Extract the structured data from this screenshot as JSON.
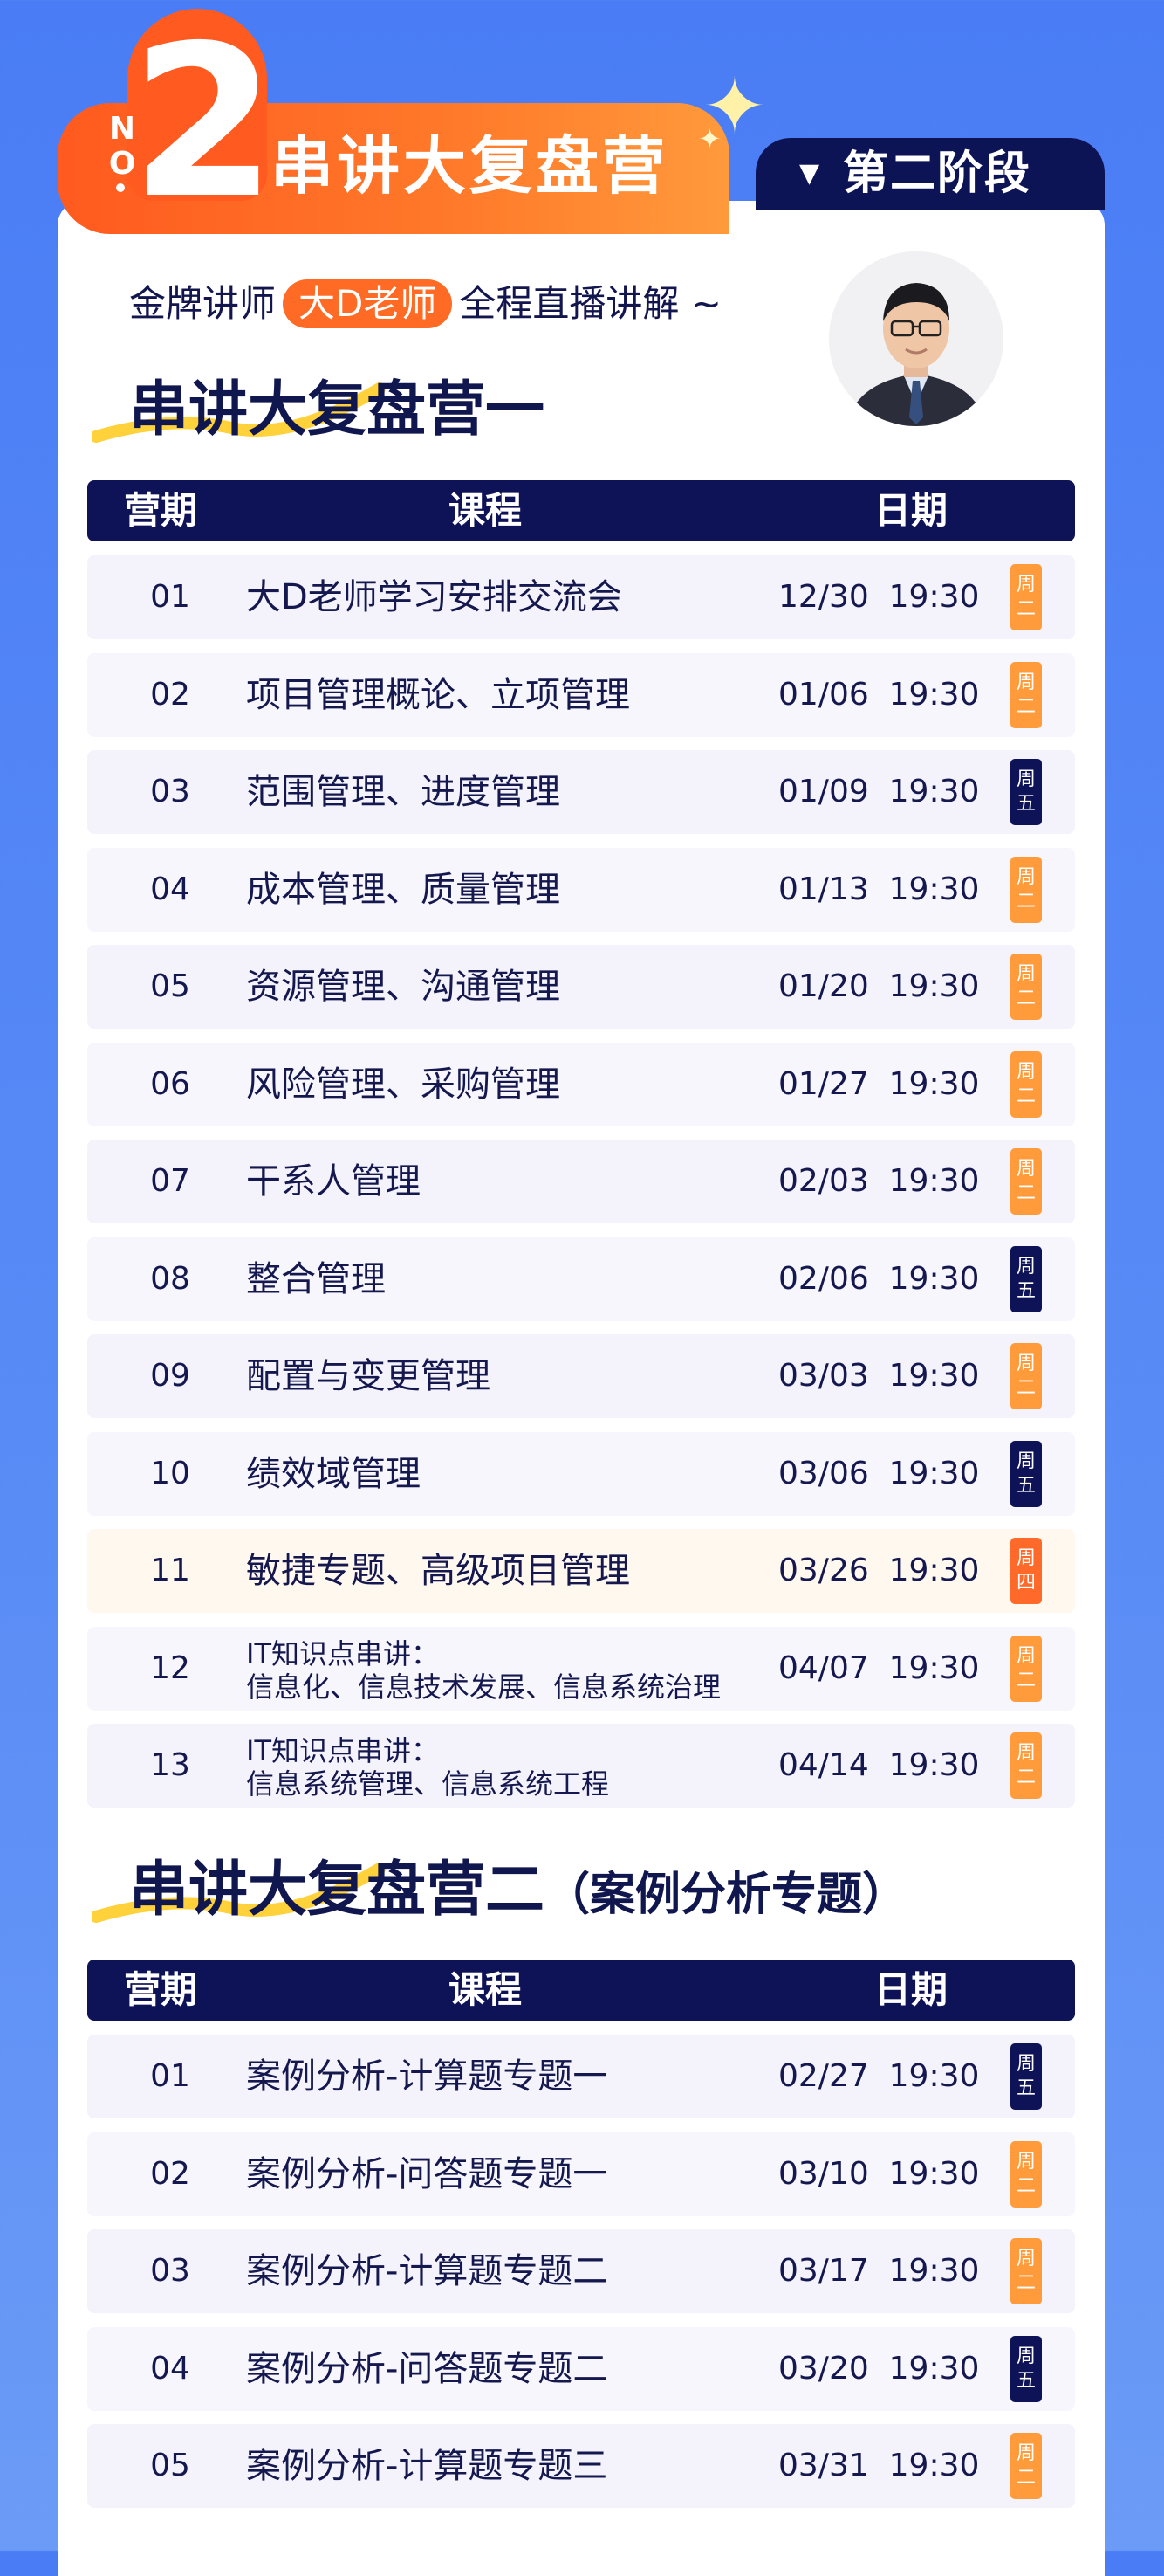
{
  "header": {
    "no_label": "NO",
    "number": "2",
    "camp_title": "串讲大复盘营",
    "stage": "第二阶段"
  },
  "intro": {
    "prefix": "金牌讲师",
    "teacher": "大D老师",
    "suffix": "全程直播讲解 ~"
  },
  "colors": {
    "navy": "#0e1257",
    "orange": "#ff9b3b",
    "accent": "#ff6a25",
    "background": "#4a7df5"
  },
  "section1": {
    "title": "串讲大复盘营一",
    "headers": {
      "period": "营期",
      "course": "课程",
      "date": "日期"
    },
    "rows": [
      {
        "num": "01",
        "course": "大D老师学习安排交流会",
        "date": "12/30  19:30",
        "week": [
          "周",
          "二"
        ],
        "color": "orange"
      },
      {
        "num": "02",
        "course": "项目管理概论、立项管理",
        "date": "01/06  19:30",
        "week": [
          "周",
          "二"
        ],
        "color": "orange"
      },
      {
        "num": "03",
        "course": "范围管理、进度管理",
        "date": "01/09  19:30",
        "week": [
          "周",
          "五"
        ],
        "color": "navy"
      },
      {
        "num": "04",
        "course": "成本管理、质量管理",
        "date": "01/13  19:30",
        "week": [
          "周",
          "二"
        ],
        "color": "orange"
      },
      {
        "num": "05",
        "course": "资源管理、沟通管理",
        "date": "01/20  19:30",
        "week": [
          "周",
          "二"
        ],
        "color": "orange"
      },
      {
        "num": "06",
        "course": "风险管理、采购管理",
        "date": "01/27  19:30",
        "week": [
          "周",
          "二"
        ],
        "color": "orange"
      },
      {
        "num": "07",
        "course": "干系人管理",
        "date": "02/03  19:30",
        "week": [
          "周",
          "二"
        ],
        "color": "orange"
      },
      {
        "num": "08",
        "course": "整合管理",
        "date": "02/06  19:30",
        "week": [
          "周",
          "五"
        ],
        "color": "navy"
      },
      {
        "num": "09",
        "course": "配置与变更管理",
        "date": "03/03  19:30",
        "week": [
          "周",
          "二"
        ],
        "color": "orange"
      },
      {
        "num": "10",
        "course": "绩效域管理",
        "date": "03/06  19:30",
        "week": [
          "周",
          "五"
        ],
        "color": "navy"
      },
      {
        "num": "11",
        "course": "敏捷专题、高级项目管理",
        "date": "03/26  19:30",
        "week": [
          "周",
          "四"
        ],
        "color": "red"
      },
      {
        "num": "12",
        "course_l1": "IT知识点串讲：",
        "course_l2": "信息化、信息技术发展、信息系统治理",
        "date": "04/07  19:30",
        "week": [
          "周",
          "二"
        ],
        "color": "orange"
      },
      {
        "num": "13",
        "course_l1": "IT知识点串讲：",
        "course_l2": "信息系统管理、信息系统工程",
        "date": "04/14  19:30",
        "week": [
          "周",
          "二"
        ],
        "color": "orange"
      }
    ]
  },
  "section2": {
    "title": "串讲大复盘营二",
    "subtitle": "（案例分析专题）",
    "headers": {
      "period": "营期",
      "course": "课程",
      "date": "日期"
    },
    "rows": [
      {
        "num": "01",
        "course": "案例分析-计算题专题一",
        "date": "02/27  19:30",
        "week": [
          "周",
          "五"
        ],
        "color": "navy"
      },
      {
        "num": "02",
        "course": "案例分析-问答题专题一",
        "date": "03/10  19:30",
        "week": [
          "周",
          "二"
        ],
        "color": "orange"
      },
      {
        "num": "03",
        "course": "案例分析-计算题专题二",
        "date": "03/17  19:30",
        "week": [
          "周",
          "二"
        ],
        "color": "orange"
      },
      {
        "num": "04",
        "course": "案例分析-问答题专题二",
        "date": "03/20  19:30",
        "week": [
          "周",
          "五"
        ],
        "color": "navy"
      },
      {
        "num": "05",
        "course": "案例分析-计算题专题三",
        "date": "03/31  19:30",
        "week": [
          "周",
          "二"
        ],
        "color": "orange"
      }
    ]
  }
}
